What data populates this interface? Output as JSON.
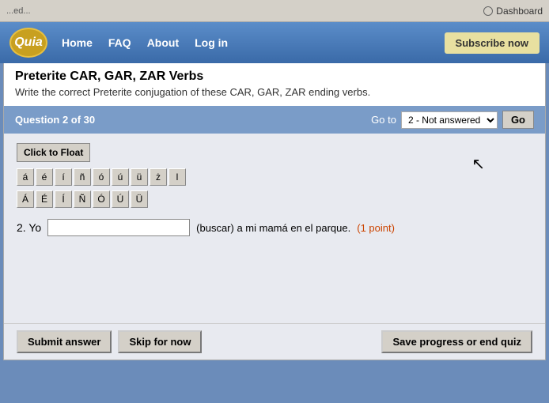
{
  "browser": {
    "dashboard_text": "Dashboard"
  },
  "nav": {
    "logo_text": "Quia",
    "home_label": "Home",
    "faq_label": "FAQ",
    "about_label": "About",
    "login_label": "Log in",
    "subscribe_label": "Subscribe now"
  },
  "page": {
    "title": "Preterite CAR, GAR, ZAR Verbs",
    "subtitle": "Write the correct Preterite conjugation of these CAR, GAR, ZAR ending verbs."
  },
  "question_bar": {
    "question_label": "Question 2 of 30",
    "goto_text": "Go to",
    "goto_option": "2 - Not answered",
    "go_button": "Go"
  },
  "special_chars_row1": [
    "á",
    "é",
    "í",
    "ñ",
    "ó",
    "ú",
    "ü",
    "ż",
    "l"
  ],
  "special_chars_row2": [
    "Á",
    "É",
    "Í",
    "Ñ",
    "Ó",
    "Ú",
    "Ü"
  ],
  "float_btn": "Click to Float",
  "question": {
    "number": "2. Yo",
    "input_placeholder": "",
    "rest_text": "(buscar) a mi mamá en el parque.",
    "point_text": "(1 point)"
  },
  "buttons": {
    "submit_label": "Submit answer",
    "skip_label": "Skip for now",
    "save_label": "Save progress or end quiz"
  }
}
